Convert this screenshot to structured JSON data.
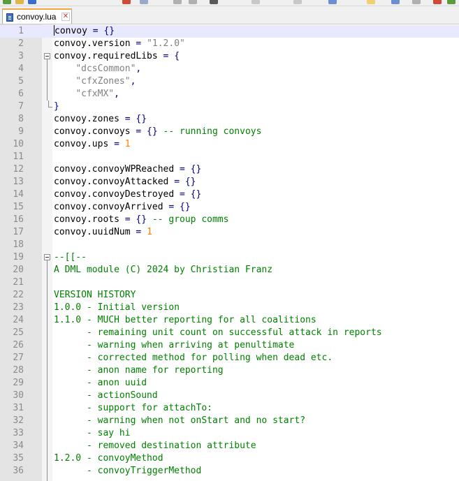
{
  "tab": {
    "label": "convoy.lua",
    "close_icon": "close-icon",
    "file_icon": "lua-file-icon"
  },
  "editor": {
    "current_line": 1,
    "lines": [
      {
        "n": "1",
        "segs": [
          [
            "t",
            "convoy "
          ],
          [
            "o",
            "= {}"
          ]
        ]
      },
      {
        "n": "2",
        "segs": [
          [
            "t",
            "convoy.version "
          ],
          [
            "o",
            "= "
          ],
          [
            "s",
            "\"1.2.0\""
          ]
        ]
      },
      {
        "n": "3",
        "fold": "open",
        "segs": [
          [
            "t",
            "convoy.requiredLibs "
          ],
          [
            "o",
            "= {"
          ]
        ]
      },
      {
        "n": "4",
        "segs": [
          [
            "t",
            "    "
          ],
          [
            "s",
            "\"dcsCommon\""
          ],
          [
            "o",
            ","
          ]
        ]
      },
      {
        "n": "5",
        "segs": [
          [
            "t",
            "    "
          ],
          [
            "s",
            "\"cfxZones\""
          ],
          [
            "o",
            ","
          ]
        ]
      },
      {
        "n": "6",
        "segs": [
          [
            "t",
            "    "
          ],
          [
            "s",
            "\"cfxMX\""
          ],
          [
            "o",
            ","
          ]
        ]
      },
      {
        "n": "7",
        "fold": "end",
        "segs": [
          [
            "o",
            "}"
          ]
        ]
      },
      {
        "n": "8",
        "segs": [
          [
            "t",
            "convoy.zones "
          ],
          [
            "o",
            "= {}"
          ]
        ]
      },
      {
        "n": "9",
        "segs": [
          [
            "t",
            "convoy.convoys "
          ],
          [
            "o",
            "= {} "
          ],
          [
            "c",
            "-- running convoys"
          ]
        ]
      },
      {
        "n": "10",
        "segs": [
          [
            "t",
            "convoy.ups "
          ],
          [
            "o",
            "= "
          ],
          [
            "n",
            "1"
          ]
        ]
      },
      {
        "n": "11",
        "segs": []
      },
      {
        "n": "12",
        "segs": [
          [
            "t",
            "convoy.convoyWPReached "
          ],
          [
            "o",
            "= {}"
          ]
        ]
      },
      {
        "n": "13",
        "segs": [
          [
            "t",
            "convoy.convoyAttacked "
          ],
          [
            "o",
            "= {}"
          ]
        ]
      },
      {
        "n": "14",
        "segs": [
          [
            "t",
            "convoy.convoyDestroyed "
          ],
          [
            "o",
            "= {}"
          ]
        ]
      },
      {
        "n": "15",
        "segs": [
          [
            "t",
            "convoy.convoyArrived "
          ],
          [
            "o",
            "= {}"
          ]
        ]
      },
      {
        "n": "16",
        "segs": [
          [
            "t",
            "convoy.roots "
          ],
          [
            "o",
            "= {} "
          ],
          [
            "c",
            "-- group comms"
          ]
        ]
      },
      {
        "n": "17",
        "segs": [
          [
            "t",
            "convoy.uuidNum "
          ],
          [
            "o",
            "= "
          ],
          [
            "n",
            "1"
          ]
        ]
      },
      {
        "n": "18",
        "segs": []
      },
      {
        "n": "19",
        "fold": "open",
        "segs": [
          [
            "c",
            "--[[--"
          ]
        ]
      },
      {
        "n": "20",
        "segs": [
          [
            "c",
            "A DML module (C) 2024 by Christian Franz"
          ]
        ]
      },
      {
        "n": "21",
        "segs": []
      },
      {
        "n": "22",
        "segs": [
          [
            "c",
            "VERSION HISTORY"
          ]
        ]
      },
      {
        "n": "23",
        "segs": [
          [
            "c",
            "1.0.0 - Initial version"
          ]
        ]
      },
      {
        "n": "24",
        "segs": [
          [
            "c",
            "1.1.0 - MUCH better reporting for all coalitions"
          ]
        ]
      },
      {
        "n": "25",
        "segs": [
          [
            "c",
            "      - remaining unit count on successful attack in reports"
          ]
        ]
      },
      {
        "n": "26",
        "segs": [
          [
            "c",
            "      - warning when arriving at penultimate"
          ]
        ]
      },
      {
        "n": "27",
        "segs": [
          [
            "c",
            "      - corrected method for polling when dead etc."
          ]
        ]
      },
      {
        "n": "28",
        "segs": [
          [
            "c",
            "      - anon name for reporting"
          ]
        ]
      },
      {
        "n": "29",
        "segs": [
          [
            "c",
            "      - anon uuid"
          ]
        ]
      },
      {
        "n": "30",
        "segs": [
          [
            "c",
            "      - actionSound"
          ]
        ]
      },
      {
        "n": "31",
        "segs": [
          [
            "c",
            "      - support for attachTo:"
          ]
        ]
      },
      {
        "n": "32",
        "segs": [
          [
            "c",
            "      - warning when not onStart and no start?"
          ]
        ]
      },
      {
        "n": "33",
        "segs": [
          [
            "c",
            "      - say hi"
          ]
        ]
      },
      {
        "n": "34",
        "segs": [
          [
            "c",
            "      - removed destination attribute"
          ]
        ]
      },
      {
        "n": "35",
        "segs": [
          [
            "c",
            "1.2.0 - convoyMethod"
          ]
        ]
      },
      {
        "n": "36",
        "segs": [
          [
            "c",
            "      - convoyTriggerMethod"
          ]
        ]
      }
    ]
  },
  "colors": {
    "keyword_operator": "#000080",
    "string": "#808080",
    "number": "#ff8000",
    "comment": "#008000",
    "tab_accent": "#f3a64a",
    "line_number": "#8a8a8a",
    "current_line_bg": "#e8e8ff"
  }
}
